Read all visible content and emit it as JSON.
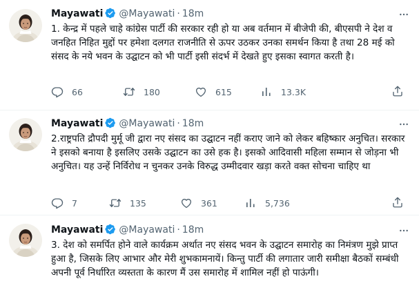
{
  "tweets": [
    {
      "name": "Mayawati",
      "handle": "@Mayawati",
      "separator": "·",
      "time": "18m",
      "text": "1. केन्द्र में पहले चाहे कांग्रेस पार्टी की सरकार रही हो या अब वर्तमान में बीजेपी की, बीएसपी ने देश व जनहित निहित मुद्दों पर हमेशा दलगत राजनीति से ऊपर उठकर उनका समर्थन किया है तथा 28 मई को संसद के नये भवन के उद्घाटन को भी पार्टी इसी संदर्भ में देखते हुए इसका स्वागत करती है।",
      "replies": "66",
      "retweets": "180",
      "likes": "615",
      "views": "13.3K"
    },
    {
      "name": "Mayawati",
      "handle": "@Mayawati",
      "separator": "·",
      "time": "18m",
      "text": "2.राष्ट्रपति द्रौपदी मुर्मू जी द्वारा नए संसद का उद्घाटन नहीं कराए जाने को लेकर बहिष्कार अनुचित। सरकार ने इसको बनाया है इसलिए उसके उद्घाटन का उसे हक है। इसको आदिवासी महिला सम्मान से जोड़ना भी अनुचित। यह उन्हें निर्विरोध न चुनकर उनके विरुद्ध उम्मीदवार खड़ा करते वक्त सोचना चाहिए था",
      "replies": "7",
      "retweets": "135",
      "likes": "361",
      "views": "5,736"
    },
    {
      "name": "Mayawati",
      "handle": "@Mayawati",
      "separator": "·",
      "time": "18m",
      "text": "3. देश को समर्पित होने वाले कार्यक्रम अर्थात नए संसद भवन के उद्घाटन समारोह का निमंत्रण मुझे प्राप्त हुआ है, जिसके लिए आभार और मेरी शुभकामनायें। किन्तु पार्टी की लगातार जारी समीक्षा बैठकों सम्बंधी अपनी पूर्व निर्धारित व्यस्तता के कारण मैं उस समारोह में शामिल नहीं हो पाऊंगी।"
    }
  ],
  "icons": {
    "verified": "verified-badge-icon",
    "more": "more-options-icon",
    "reply": "reply-icon",
    "retweet": "retweet-icon",
    "like": "heart-icon",
    "views": "views-icon",
    "share": "share-icon"
  },
  "colors": {
    "verified": "#1d9bf0",
    "text": "#0f1419",
    "secondary": "#536471",
    "divider": "#eff3f4"
  }
}
